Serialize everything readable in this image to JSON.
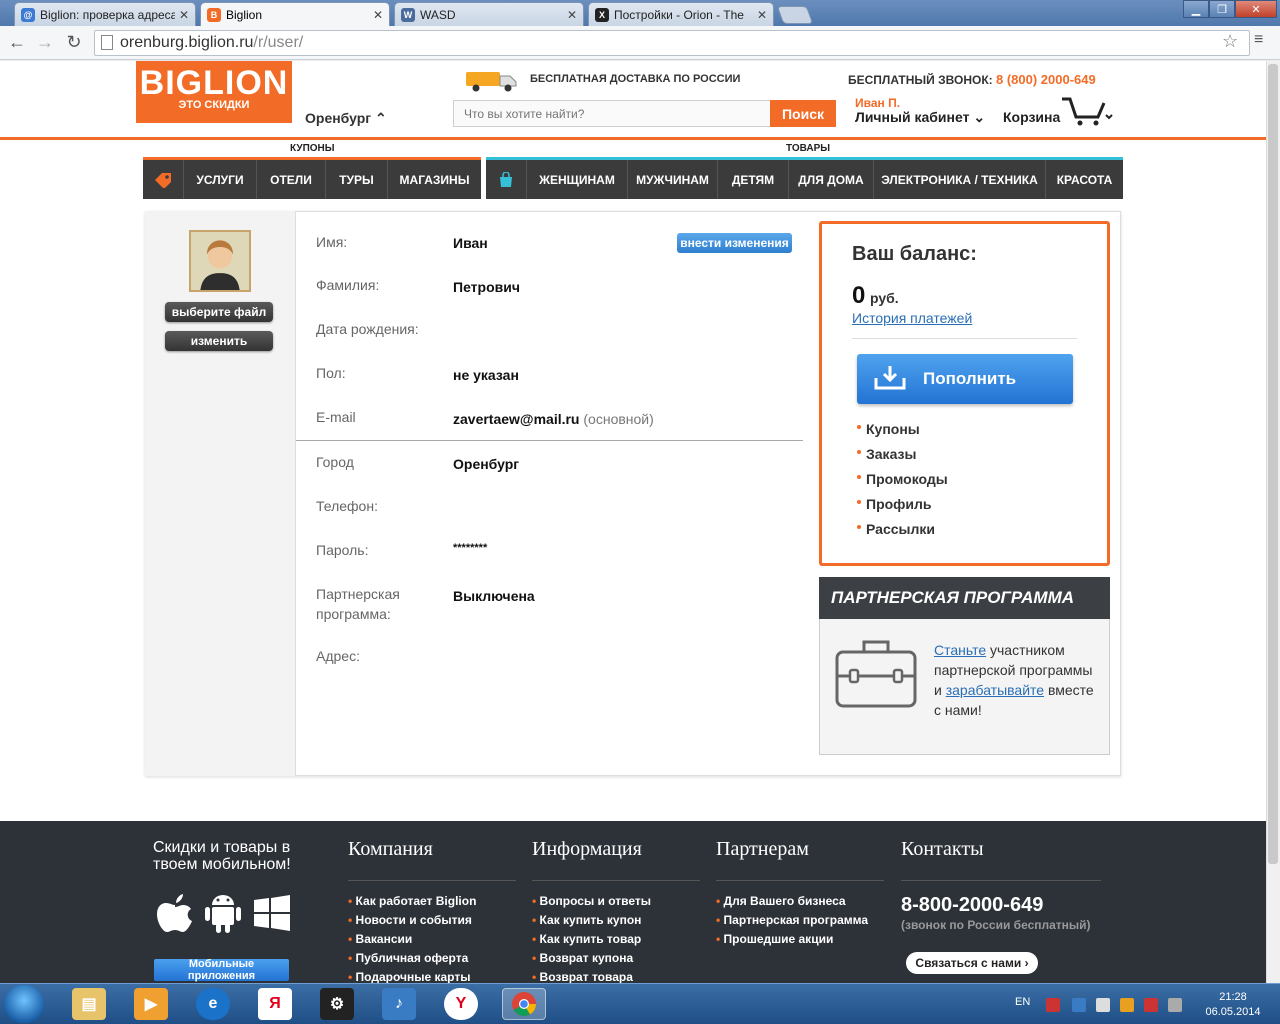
{
  "browser": {
    "tabs": [
      {
        "title": "Biglion: проверка адреса",
        "fav_color": "#3c7bd1",
        "fav": "@"
      },
      {
        "title": "Biglion",
        "fav_color": "#f26c27",
        "fav": "B"
      },
      {
        "title": "WASD",
        "fav_color": "#4a6b9c",
        "fav": "W"
      },
      {
        "title": "Постройки - Orion - The",
        "fav_color": "#222222",
        "fav": "X"
      }
    ],
    "url_host": "orenburg.biglion.ru",
    "url_path": "/r/user/"
  },
  "header": {
    "logo_main": "BIGLION",
    "logo_sub": "ЭТО СКИДКИ",
    "city": "Оренбург ⌃",
    "delivery": "БЕСПЛАТНАЯ ДОСТАВКА ПО РОССИИ",
    "search_placeholder": "Что вы хотите найти?",
    "search_button": "Поиск",
    "hotline_label": "БЕСПЛАТНЫЙ ЗВОНОК:",
    "hotline_phone": "8 (800) 2000-649",
    "user_name": "Иван П.",
    "cabinet": "Личный кабинет ⌄",
    "cart": "Корзина"
  },
  "nav": {
    "coupons_label": "КУПОНЫ",
    "goods_label": "ТОВАРЫ",
    "left_items": [
      "УСЛУГИ",
      "ОТЕЛИ",
      "ТУРЫ",
      "МАГАЗИНЫ"
    ],
    "right_items": [
      "ЖЕНЩИНАМ",
      "МУЖЧИНАМ",
      "ДЕТЯМ",
      "ДЛЯ ДОМА",
      "ЭЛЕКТРОНИКА / ТЕХНИКА",
      "КРАСОТА"
    ]
  },
  "profile": {
    "choose_file": "выберите файл",
    "change": "изменить",
    "edit_button": "внести изменения",
    "fields": [
      {
        "label": "Имя:",
        "value": "Иван"
      },
      {
        "label": "Фамилия:",
        "value": "Петрович"
      },
      {
        "label": "Дата рождения:",
        "value": ""
      },
      {
        "label": "Пол:",
        "value": "не указан"
      },
      {
        "label": "E-mail",
        "value": "zavertaew@mail.ru",
        "note": "(основной)"
      },
      {
        "label": "Город",
        "value": "Оренбург"
      },
      {
        "label": "Телефон:",
        "value": ""
      },
      {
        "label": "Пароль:",
        "value": "********"
      },
      {
        "label": "Партнерская",
        "label2": "программа:",
        "value": "Выключена"
      },
      {
        "label": "Адрес:",
        "value": ""
      }
    ]
  },
  "balance": {
    "title": "Ваш баланс:",
    "amount": "0",
    "currency": "руб.",
    "history": "История платежей",
    "topup": "Пополнить",
    "menu": [
      "Купоны",
      "Заказы",
      "Промокоды",
      "Профиль",
      "Рассылки"
    ]
  },
  "partner": {
    "title": "ПАРТНЕРСКАЯ ПРОГРАММА",
    "link1": "Станьте",
    "text1": " участником партнерской программы и ",
    "link2": "зарабатывайте",
    "text2": " вместе с нами!"
  },
  "footer": {
    "mobile_title": "Скидки и товары в твоем мобильном!",
    "apps_button": "Мобильные приложения",
    "columns": [
      {
        "title": "Компания",
        "links": [
          "Как работает Biglion",
          "Новости и события",
          "Вакансии",
          "Публичная оферта",
          "Подарочные карты"
        ]
      },
      {
        "title": "Информация",
        "links": [
          "Вопросы и ответы",
          "Как купить купон",
          "Как купить товар",
          "Возврат купона",
          "Возврат товара"
        ]
      },
      {
        "title": "Партнерам",
        "links": [
          "Для Вашего бизнеса",
          "Партнерская программа",
          "Прошедшие акции"
        ]
      },
      {
        "title": "Контакты",
        "links": []
      }
    ],
    "phone": "8-800-2000-649",
    "phone_note": "(звонок по России бесплатный)",
    "contact_button": "Связаться с нами ›"
  },
  "taskbar": {
    "lang": "EN",
    "time": "21:28",
    "date": "06.05.2014"
  },
  "colors": {
    "brand": "#f26c27",
    "link": "#2a6fb5",
    "accent_goods": "#35c0d8"
  }
}
